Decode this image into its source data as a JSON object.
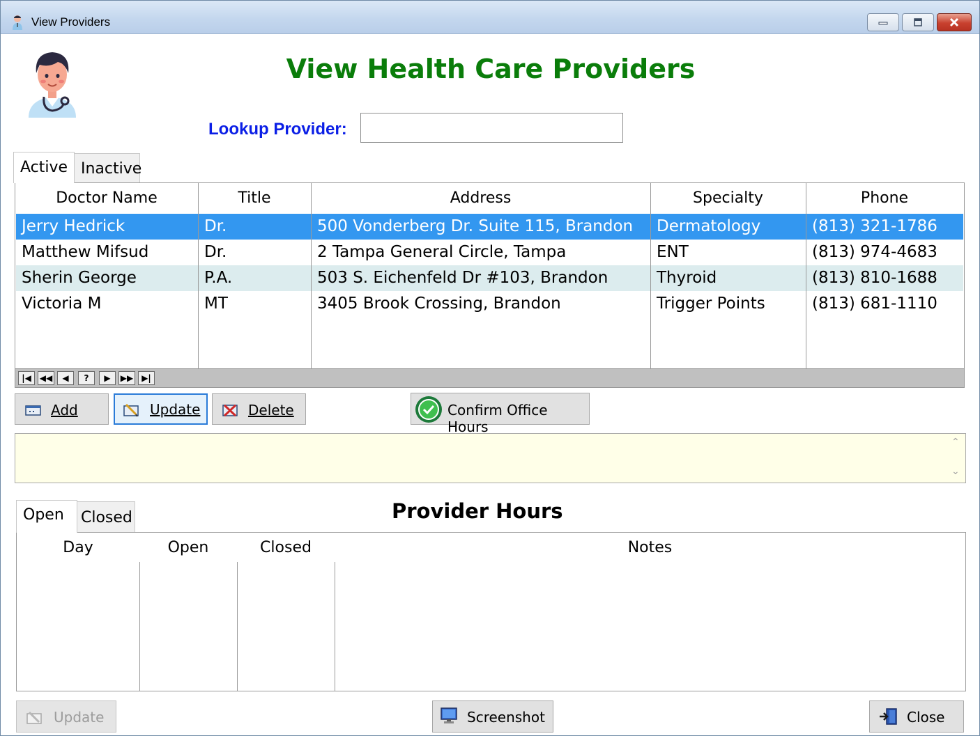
{
  "window": {
    "title": "View Providers",
    "icon": "doctor-icon"
  },
  "header": {
    "heading": "View Health Care Providers",
    "heading_color": "#0a7d0a",
    "lookup_label": "Lookup Provider:",
    "lookup_value": ""
  },
  "provider_tabs": {
    "active": "Active",
    "inactive": "Inactive"
  },
  "providers_grid": {
    "columns": [
      "Doctor Name",
      "Title",
      "Address",
      "Specialty",
      "Phone"
    ],
    "rows": [
      [
        "Jerry Hedrick",
        "Dr.",
        "500 Vonderberg Dr. Suite 115, Brandon",
        "Dermatology",
        "(813) 321-1786"
      ],
      [
        "Matthew Mifsud",
        "Dr.",
        "2 Tampa General Circle, Tampa",
        "ENT",
        "(813) 974-4683"
      ],
      [
        "Sherin George",
        "P.A.",
        "503 S. Eichenfeld Dr #103, Brandon",
        "Thyroid",
        "(813) 810-1688"
      ],
      [
        "Victoria M",
        "MT",
        "3405 Brook Crossing, Brandon",
        "Trigger Points",
        "(813) 681-1110"
      ]
    ],
    "selected_row": 0,
    "selection_color": "#3397f0",
    "navigator": [
      "|◀",
      "◀◀",
      "◀",
      "?",
      "▶",
      "▶▶",
      "▶|"
    ]
  },
  "actions": {
    "add": "Add",
    "update": "Update",
    "delete": "Delete",
    "confirm": "Confirm Office Hours"
  },
  "hours_section": {
    "title": "Provider Hours",
    "tabs": {
      "open": "Open",
      "closed": "Closed"
    },
    "columns": [
      "Day",
      "Open",
      "Closed",
      "Notes"
    ]
  },
  "footer": {
    "update": "Update",
    "screenshot": "Screenshot",
    "close": "Close"
  }
}
